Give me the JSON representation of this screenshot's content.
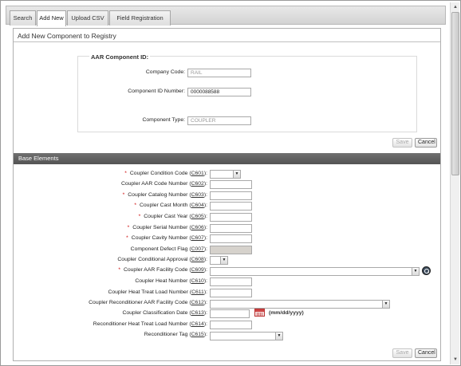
{
  "tabs": [
    {
      "label": "Search"
    },
    {
      "label": "Add New"
    },
    {
      "label": "Upload CSV"
    },
    {
      "label": "Field Registration"
    }
  ],
  "panel": {
    "title": "Add New Component to Registry",
    "id_section": {
      "legend": "AAR Component ID:",
      "company_code": {
        "label": "Company Code:",
        "value": "RAIL"
      },
      "component_id_number": {
        "label": "Component ID Number:",
        "value": "0000088588"
      }
    },
    "component_type": {
      "label": "Component Type:",
      "value": "COUPLER"
    },
    "save_label": "Save",
    "cancel_label": "Cancel"
  },
  "base_elements": {
    "title": "Base Elements",
    "fields": [
      {
        "label": "Coupler Condition Code (",
        "code": "C601",
        "required": true
      },
      {
        "label": "Coupler AAR Code Number (",
        "code": "C602",
        "required": false
      },
      {
        "label": "Coupler Catalog Number (",
        "code": "C603",
        "required": true
      },
      {
        "label": "Coupler Cast Month (",
        "code": "C604",
        "required": true
      },
      {
        "label": "Coupler Cast Year (",
        "code": "C605",
        "required": true
      },
      {
        "label": "Coupler Serial Number (",
        "code": "C606",
        "required": true
      },
      {
        "label": "Coupler Cavity Number (",
        "code": "C607",
        "required": true
      },
      {
        "label": "Component Defect Flag (",
        "code": "C007",
        "required": false
      },
      {
        "label": "Coupler Conditional Approval (",
        "code": "C608",
        "required": false
      },
      {
        "label": "Coupler AAR Facility Code (",
        "code": "C609",
        "required": true
      },
      {
        "label": "Coupler Heat Number (",
        "code": "C610",
        "required": false
      },
      {
        "label": "Coupler Heat Treat Load Number (",
        "code": "C611",
        "required": false
      },
      {
        "label": "Coupler Reconditioner AAR Facility Code (",
        "code": "C612",
        "required": false
      },
      {
        "label": "Coupler Classification Date (",
        "code": "C613",
        "required": false
      },
      {
        "label": "Reconditioner Heat Treat Load Number (",
        "code": "C614",
        "required": false
      },
      {
        "label": "Reconditioner Tag (",
        "code": "C615",
        "required": false
      }
    ],
    "close_paren": "):",
    "required_marker": "*",
    "date_format_hint": "(mm/dd/yyyy)",
    "save_label": "Save",
    "cancel_label": "Cancel"
  },
  "icons": {
    "calendar": "calendar-icon",
    "search": "search-icon",
    "dropdown": "chevron-down-icon"
  }
}
